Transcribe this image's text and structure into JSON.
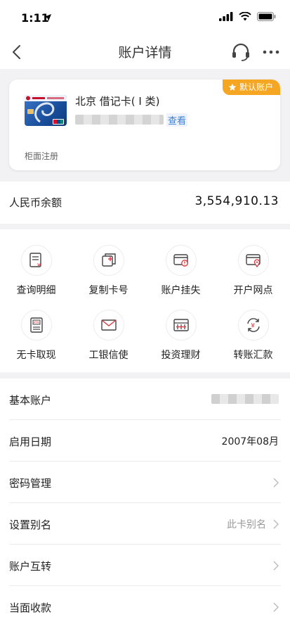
{
  "status": {
    "time": "1:11"
  },
  "nav": {
    "title": "账户详情"
  },
  "card": {
    "badge": "默认账户",
    "title": "北京 借记卡( Ⅰ 类)",
    "view": "查看",
    "subtitle": "柜面注册"
  },
  "balance": {
    "label": "人民币余额",
    "value": "3,554,910.13"
  },
  "grid": [
    {
      "label": "查询明细",
      "icon": "query-details-icon"
    },
    {
      "label": "复制卡号",
      "icon": "copy-card-icon"
    },
    {
      "label": "账户挂失",
      "icon": "report-loss-icon"
    },
    {
      "label": "开户网点",
      "icon": "branch-icon"
    },
    {
      "label": "无卡取现",
      "icon": "atm-icon"
    },
    {
      "label": "工银信使",
      "icon": "mail-icon"
    },
    {
      "label": "投资理财",
      "icon": "invest-icon"
    },
    {
      "label": "转账汇款",
      "icon": "transfer-icon"
    }
  ],
  "list": [
    {
      "label": "基本账户"
    },
    {
      "label": "启用日期",
      "value": "2007年08月"
    },
    {
      "label": "密码管理"
    },
    {
      "label": "设置别名",
      "hint": "此卡别名"
    },
    {
      "label": "账户互转"
    },
    {
      "label": "当面收款"
    }
  ],
  "colors": {
    "badge": "#f5a623",
    "link": "#3d7fd0",
    "accent": "#d9363e"
  }
}
